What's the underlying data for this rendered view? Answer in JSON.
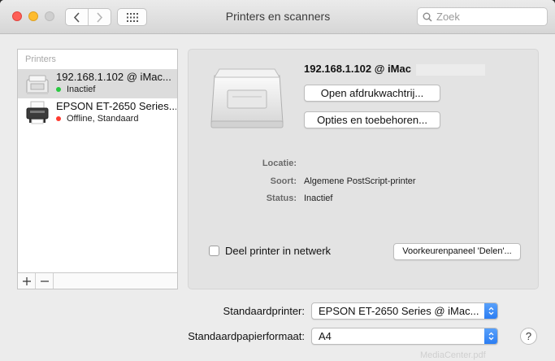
{
  "window": {
    "title": "Printers en scanners"
  },
  "search": {
    "placeholder": "Zoek"
  },
  "printer_list": {
    "header": "Printers",
    "items": [
      {
        "name": "192.168.1.102 @ iMac...",
        "status": "Inactief",
        "status_color": "#27c93f",
        "selected": true
      },
      {
        "name": "EPSON ET-2650 Series...",
        "status": "Offline, Standaard",
        "status_color": "#ff3b30",
        "selected": false
      }
    ],
    "add_label": "+",
    "remove_label": "−"
  },
  "detail": {
    "printer_name": "192.168.1.102 @ iMac",
    "open_queue_label": "Open afdrukwachtrij...",
    "options_label": "Opties en toebehoren...",
    "location_label": "Locatie:",
    "location_value": "",
    "kind_label": "Soort:",
    "kind_value": "Algemene PostScript-printer",
    "status_label": "Status:",
    "status_value": "Inactief",
    "share_label": "Deel printer in netwerk",
    "share_checked": false,
    "sharing_prefs_label": "Voorkeurenpaneel 'Delen'..."
  },
  "bottom": {
    "default_printer_label": "Standaardprinter:",
    "default_printer_value": "EPSON ET-2650 Series @ iMac...",
    "paper_size_label": "Standaardpapierformaat:",
    "paper_size_value": "A4",
    "help_label": "?"
  },
  "watermark": "MediaCenter.pdf",
  "icons": {
    "close": "close-dot",
    "minimize": "minimize-dot",
    "zoom": "zoom-dot",
    "back": "chevron-left-icon",
    "forward": "chevron-right-icon",
    "grid": "grid-icon",
    "search": "search-icon",
    "popup": "updown-chevron-icon"
  },
  "colors": {
    "accent": "#2a7cf2",
    "selection": "#dcdcdc",
    "close": "#fe5f57",
    "minimize": "#febc2e"
  }
}
